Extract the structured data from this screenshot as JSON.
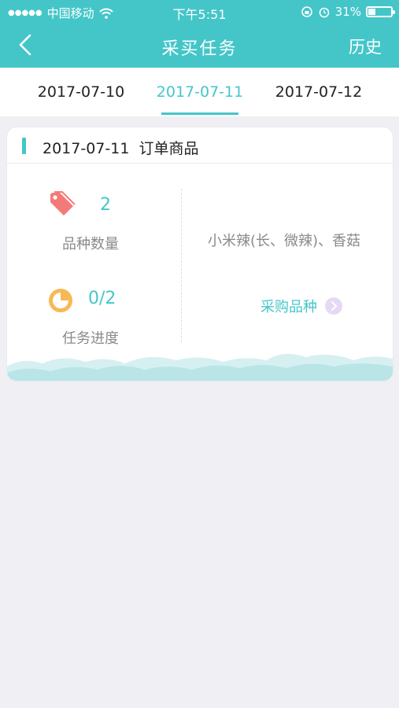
{
  "status_bar": {
    "carrier": "中国移动",
    "time": "下午5:51",
    "battery": "31%",
    "battery_level": 0.31
  },
  "navbar": {
    "title": "采买任务",
    "history": "历史"
  },
  "tabs": [
    {
      "label": "2017-07-10",
      "selected": false
    },
    {
      "label": "2017-07-11",
      "selected": true
    },
    {
      "label": "2017-07-12",
      "selected": false
    }
  ],
  "card": {
    "title": "2017-07-11  订单商品",
    "kind_count": "2",
    "kind_label": "品种数量",
    "progress_value": "0/2",
    "progress_label": "任务进度",
    "goods": "小米辣(长、微辣)、香菇",
    "purchase_link": "采购品种"
  },
  "colors": {
    "accent": "#44c6c9",
    "tag": "#f47a7a",
    "progress": "#f7b955",
    "chevron_bg": "#e6d9f5"
  },
  "icons": {
    "back": "chevron-left-icon",
    "tag": "tag-icon",
    "progress": "pie-progress-icon",
    "link": "chevron-right-circle-icon"
  }
}
